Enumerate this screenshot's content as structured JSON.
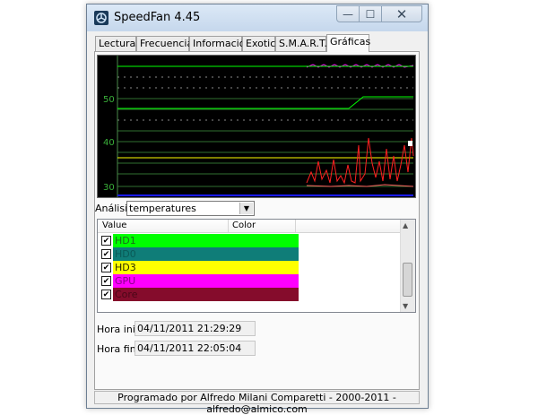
{
  "window": {
    "title": "SpeedFan 4.45",
    "controls": {
      "minimize": "—",
      "maximize": "☐",
      "close": "✕"
    }
  },
  "tabs": [
    {
      "label": "Lecturas"
    },
    {
      "label": "Frecuencia"
    },
    {
      "label": "Información"
    },
    {
      "label": "Exotics"
    },
    {
      "label": "S.M.A.R.T."
    },
    {
      "label": "Gráficas",
      "active": true
    }
  ],
  "graph": {
    "y_labels": [
      "50",
      "40",
      "30"
    ],
    "background": "#000000",
    "grid_color": "#2f6f2f",
    "series_colors": {
      "HD1": "#00ff00",
      "HD0": "#00908a",
      "HD3": "#ffff00",
      "GPU": "#ff00ff",
      "Core": "#ff2020"
    }
  },
  "analysis": {
    "label": "Análisis",
    "selected": "temperatures"
  },
  "list": {
    "columns": [
      "Value",
      "Color"
    ],
    "items": [
      {
        "name": "HD1",
        "color": "#00ff00",
        "text_color": "#1a6c1a",
        "checked": true
      },
      {
        "name": "HD0",
        "color": "#0f7d78",
        "text_color": "#0a5a57",
        "checked": true
      },
      {
        "name": "HD3",
        "color": "#ffff00",
        "text_color": "#2a2a00",
        "checked": true
      },
      {
        "name": "GPU",
        "color": "#ff00ff",
        "text_color": "#8a008a",
        "checked": true
      },
      {
        "name": "Core",
        "color": "#850c2c",
        "text_color": "#4a0718",
        "checked": true
      }
    ]
  },
  "times": {
    "start_label": "Hora inicio",
    "start_value": "04/11/2011 21:29:29",
    "end_label": "Hora fin",
    "end_value": "04/11/2011 22:05:04"
  },
  "status": {
    "text": "Programado por Alfredo Milani Comparetti - 2000-2011 - alfredo@almico.com"
  }
}
